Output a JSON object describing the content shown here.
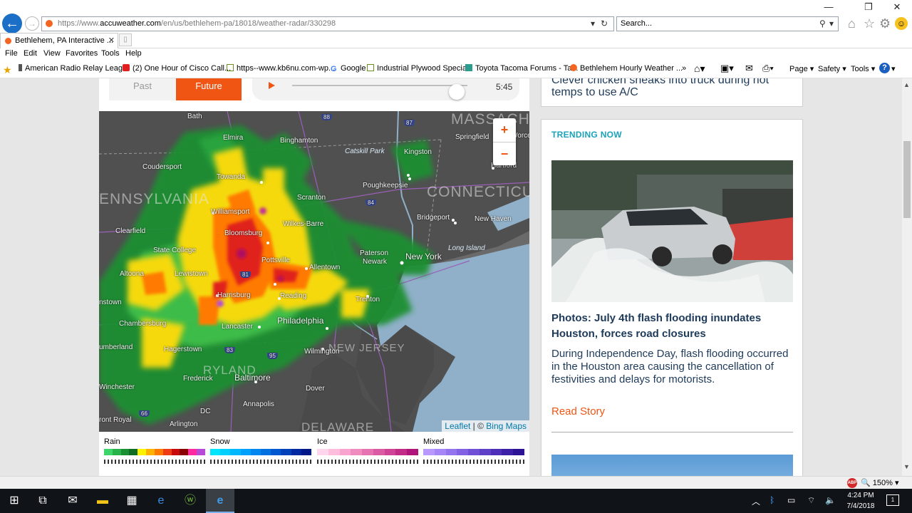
{
  "browser": {
    "url_prefix": "https://www.",
    "url_host": "accuweather.com",
    "url_path": "/en/us/bethlehem-pa/18018/weather-radar/330298",
    "search_placeholder": "Search...",
    "tab_title": "Bethlehem, PA Interactive ...",
    "menu": [
      "File",
      "Edit",
      "View",
      "Favorites",
      "Tools",
      "Help"
    ],
    "favorites": [
      "American Radio Relay Leag...",
      "(2) One Hour of Cisco Call...",
      "https--www.kb6nu.com-wp...",
      "Google",
      "Industrial Plywood Specials",
      "Toyota Tacoma Forums - Ta...",
      "Bethlehem Hourly Weather ..."
    ],
    "command_bar": [
      "Page ▾",
      "Safety ▾",
      "Tools ▾"
    ],
    "zoom_level": "150%"
  },
  "radar": {
    "past_label": "Past",
    "future_label": "Future",
    "time": "5:45",
    "playback_progress": 0.94,
    "attribution_leaflet": "Leaflet",
    "attribution_sep": " | © ",
    "attribution_bing": "Bing Maps",
    "zoom_in": "+",
    "zoom_out": "−",
    "labels": {
      "massachusetts": "MASSACHUS",
      "connecticut": "CONNECTICU",
      "pennsylvania": "ENNSYLVANIA",
      "new_jersey": "NEW JERSEY",
      "maryland": "RYLAND",
      "delaware": "DELAWARE",
      "bath": "Bath",
      "elmira": "Elmira",
      "binghamton": "Binghamton",
      "springfield": "Springfield",
      "worcester": "Worce",
      "catskill": "Catskill Park",
      "kingston": "Kingston",
      "hartford": "Hartford",
      "coudersport": "Coudersport",
      "towanda": "Towanda",
      "poughkeepsie": "Poughkeepsie",
      "scranton": "Scranton",
      "williamsport": "Williamsport",
      "bridgeport": "Bridgeport",
      "new_haven": "New Haven",
      "clearfield": "Clearfield",
      "wilkes_barre": "Wilkes-Barre",
      "bloomsburg": "Bloomsburg",
      "long_island": "Long Island",
      "state_college": "State College",
      "paterson": "Paterson",
      "newark": "Newark",
      "new_york": "New York",
      "pottsville": "Pottsville",
      "allentown": "Allentown",
      "altoona": "Altoona",
      "lewistown": "Lewistown",
      "harrisburg": "Harrisburg",
      "reading": "Reading",
      "trenton": "Trenton",
      "johnstown": "nstown",
      "philadelphia": "Philadelphia",
      "chambersburg": "Chambersburg",
      "lancaster": "Lancaster",
      "cumberland": "umberland",
      "hagerstown": "Hagerstown",
      "wilmington": "Wilmington",
      "frederick": "Frederick",
      "baltimore": "Baltimore",
      "winchester": "Winchester",
      "dover": "Dover",
      "annapolis": "Annapolis",
      "dc": "DC",
      "front_royal": "ront Royal",
      "arlington": "Arlington"
    },
    "shields": [
      "88",
      "87",
      "84",
      "81",
      "83",
      "95",
      "66"
    ],
    "legend": [
      {
        "label": "Rain",
        "colors": [
          "#3dd46a",
          "#28b34a",
          "#1a8f33",
          "#0f6d24",
          "#fff200",
          "#ffb300",
          "#ff7a00",
          "#f03c14",
          "#c80a0a",
          "#8a0000",
          "#ff2aa0",
          "#b84ad8"
        ]
      },
      {
        "label": "Snow",
        "colors": [
          "#00e5ff",
          "#00cfff",
          "#00b8ff",
          "#00a0ff",
          "#0088f0",
          "#0070e0",
          "#0058d0",
          "#0040b8",
          "#0028a0",
          "#001888"
        ]
      },
      {
        "label": "Ice",
        "colors": [
          "#ffd6ec",
          "#ffbddd",
          "#f9a4cf",
          "#f08bc0",
          "#e672b2",
          "#db5aa4",
          "#cf4296",
          "#c22a88",
          "#b0137a"
        ]
      },
      {
        "label": "Mixed",
        "colors": [
          "#b898ff",
          "#a686f6",
          "#9474ec",
          "#8262e2",
          "#7050d6",
          "#5e3fc8",
          "#4c2eb8",
          "#3b1fa6",
          "#2c1294"
        ]
      }
    ]
  },
  "sidebar": {
    "top_story": "Clever chicken sneaks into truck during hot temps to use A/C",
    "trending_label": "TRENDING NOW",
    "headline": "Photos: July 4th flash flooding inundates Houston, forces road closures",
    "summary": "During Independence Day, flash flooding occurred in the Houston area causing the cancellation of festivities and delays for motorists.",
    "read_more": "Read Story"
  },
  "taskbar": {
    "time": "4:24 PM",
    "date": "7/4/2018",
    "notification_count": "1"
  }
}
